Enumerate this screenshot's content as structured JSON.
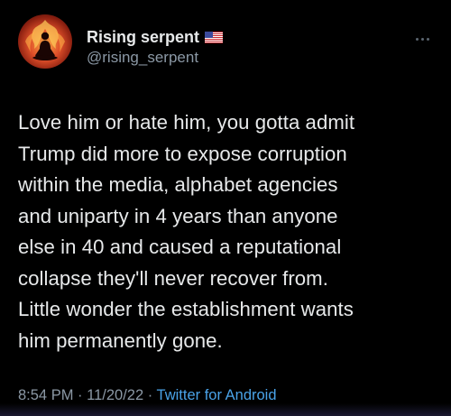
{
  "user": {
    "display_name": "Rising serpent",
    "handle": "@rising_serpent",
    "avatar_icon": "flaming-meditating-figure-avatar",
    "badge_icon": "us-flag-icon"
  },
  "tweet": {
    "text": "Love him or hate him, you gotta  admit\nTrump did more to expose corruption\nwithin the media, alphabet agencies\nand uniparty in 4 years than anyone\nelse in 40 and caused a reputational\ncollapse they'll never recover from.\nLittle wonder the establishment wants\nhim permanently gone."
  },
  "meta": {
    "time": "8:54 PM",
    "separator": "·",
    "date": "11/20/22",
    "source": "Twitter for Android"
  },
  "colors": {
    "background": "#000000",
    "primary_text": "#e7e9ea",
    "secondary_text": "#8b98a5",
    "link": "#4aa3e8"
  }
}
